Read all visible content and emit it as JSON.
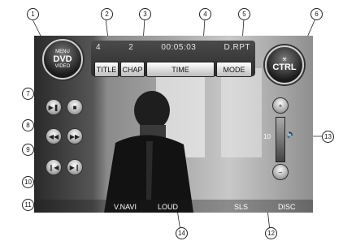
{
  "info_bar": {
    "title_num": "4",
    "chapter_num": "2",
    "time": "00:05:03",
    "mode": "D.RPT"
  },
  "top_buttons": {
    "title": "TITLE",
    "chap": "CHAP",
    "time": "TIME",
    "mode": "MODE"
  },
  "menu_button": {
    "line1": "MENU",
    "line2": "DVD",
    "line3": "VIDEO"
  },
  "ctrl_button": {
    "label": "CTRL"
  },
  "volume": {
    "plus": "+",
    "minus": "−",
    "level": "10"
  },
  "bottom_bar": {
    "items": [
      "V.NAVI",
      "LOUD",
      "SLS",
      "DISC"
    ]
  },
  "callouts": [
    "1",
    "2",
    "3",
    "4",
    "5",
    "6",
    "7",
    "8",
    "9",
    "10",
    "11",
    "12",
    "13",
    "14"
  ]
}
